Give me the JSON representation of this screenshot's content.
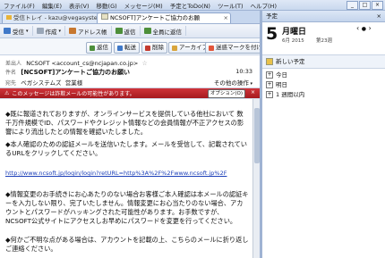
{
  "menubar": {
    "items": [
      "ファイル(F)",
      "編集(E)",
      "表示(V)",
      "移動(G)",
      "メッセージ(M)",
      "予定とToDo(N)",
      "ツール(T)",
      "ヘルプ(H)"
    ],
    "window_controls": [
      "_",
      "□",
      "×"
    ]
  },
  "tabs": [
    {
      "label": "受信トレイ - kazu@vegasystems"
    },
    {
      "label": "NCSOFT]アンケートご協力のお願"
    }
  ],
  "toolbar": {
    "receive": "受信",
    "compose": "作成",
    "addressbook": "アドレス帳",
    "reply": "返信",
    "reply_all": "全員に返信",
    "forward": "転送",
    "delete": "削除",
    "archive": "アーカイブ",
    "junk": "迷惑マークを付ける",
    "more": "その他の操作"
  },
  "header": {
    "from_label": "差出人",
    "from_value": "NCSOFT <account_cs@ncjapan.co.jp>",
    "subject_label": "件名",
    "subject_value": "[NCSOFT]アンケートご協力のお願い",
    "time": "10:33",
    "to_label": "宛先",
    "to_value": "ベガシステムズ",
    "to_suffix": "営業様"
  },
  "warning": {
    "text": "このメッセージは詐欺メールの可能性があります。",
    "option_label": "オプション(O)"
  },
  "body": {
    "p1": "◆既に報道されておりますが、オンラインサービスを提供している他社において 数千万件規模でID、パスワードやクレジット情報などの会員情報が不正アクセスの影響により流出したとの情報を確認いたしました。",
    "p2": "◆本人確認のための認証メールを送信いたします。メールを受信して、記載されているURLをクリックしてください。",
    "link": "http://www.ncsoft.jp/login/login?retURL=http%3A%2F%2Fwww.ncsoft.jp%2F",
    "p3": "◆情報変更のお手続きにお心あたりのない場合お客様ご本人確認は本メールの認証キーを入力しない限り、完了いたしません。情報変更にお心当たりのない場合、アカウントとパスワードがハッキングされた可能性があります。お手数ですが、NCSOFT公式サイトにアクセスしお早めにパスワードを変更を行ってください。",
    "p4": "◆何かご不明な点がある場合は、アカウントを記載の上、こちらのメールに折り返しご連絡ください。"
  },
  "right_pane": {
    "title": "予定",
    "day": "5",
    "weekday": "月曜日",
    "month": "6月",
    "year_info": "6月 2015",
    "week": "第23週",
    "new_task": "新しい予定",
    "rows": [
      "今日",
      "明日",
      "1 週間以内"
    ]
  },
  "colors": {
    "warning_bg": "#b8232a",
    "link": "#1c3fb8",
    "chrome": "#c9d8ee"
  }
}
